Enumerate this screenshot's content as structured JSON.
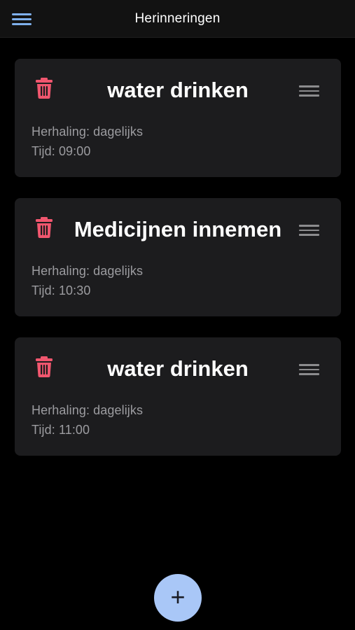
{
  "header": {
    "title": "Herinneringen",
    "menu_icon": "hamburger-menu-icon"
  },
  "colors": {
    "background": "#000000",
    "header_bg": "#121212",
    "card_bg": "#1c1c1e",
    "accent_blue": "#7fb0ec",
    "delete_red": "#f0566e",
    "secondary_text": "#9c9ca0",
    "fab_bg": "#a9c7f7"
  },
  "reminders": [
    {
      "title": "water drinken",
      "repeat": "Herhaling: dagelijks",
      "time": "Tijd: 09:00"
    },
    {
      "title": "Medicijnen innemen",
      "repeat": "Herhaling: dagelijks",
      "time": "Tijd: 10:30"
    },
    {
      "title": "water drinken",
      "repeat": "Herhaling: dagelijks",
      "time": "Tijd: 11:00"
    }
  ],
  "icons": {
    "delete": "trash-icon",
    "reorder": "drag-handle-icon",
    "add": "plus-icon"
  },
  "fab": {
    "label": "+"
  }
}
